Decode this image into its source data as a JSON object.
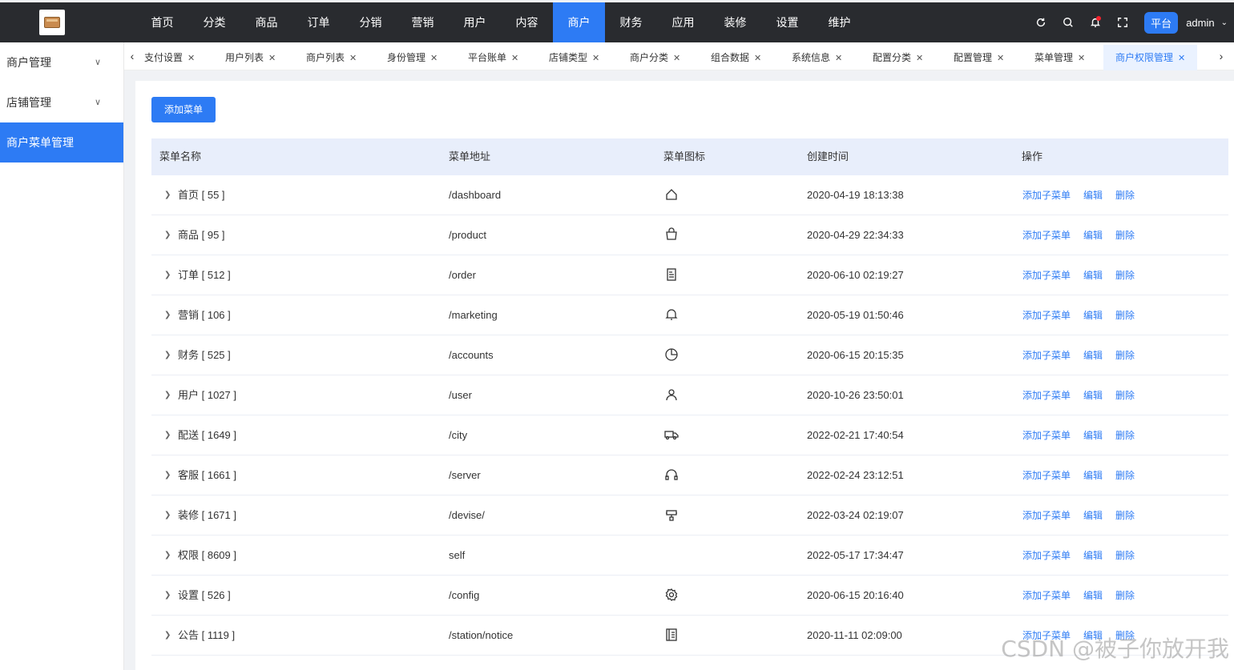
{
  "nav": [
    "首页",
    "分类",
    "商品",
    "订单",
    "分销",
    "营销",
    "用户",
    "内容",
    "商户",
    "财务",
    "应用",
    "装修",
    "设置",
    "维护"
  ],
  "nav_active": "商户",
  "topbar": {
    "platform": "平台",
    "user": "admin"
  },
  "sidebar": [
    {
      "label": "商户管理",
      "chevron": true
    },
    {
      "label": "店铺管理",
      "chevron": true
    },
    {
      "label": "商户菜单管理",
      "active": true
    }
  ],
  "tabs": [
    "支付设置",
    "用户列表",
    "商户列表",
    "身份管理",
    "平台账单",
    "店铺类型",
    "商户分类",
    "组合数据",
    "系统信息",
    "配置分类",
    "配置管理",
    "菜单管理",
    "商户权限管理"
  ],
  "tab_active": "商户权限管理",
  "add_button": "添加菜单",
  "table": {
    "headers": [
      "菜单名称",
      "菜单地址",
      "菜单图标",
      "创建时间",
      "操作"
    ],
    "rows": [
      {
        "name": "首页 [ 55 ]",
        "path": "/dashboard",
        "icon": "home-icon",
        "time": "2020-04-19 18:13:38"
      },
      {
        "name": "商品 [ 95 ]",
        "path": "/product",
        "icon": "shopping-bag-icon",
        "time": "2020-04-29 22:34:33"
      },
      {
        "name": "订单 [ 512 ]",
        "path": "/order",
        "icon": "document-icon",
        "time": "2020-06-10 02:19:27"
      },
      {
        "name": "营销 [ 106 ]",
        "path": "/marketing",
        "icon": "bell-icon",
        "time": "2020-05-19 01:50:46"
      },
      {
        "name": "财务 [ 525 ]",
        "path": "/accounts",
        "icon": "pie-chart-icon",
        "time": "2020-06-15 20:15:35"
      },
      {
        "name": "用户 [ 1027 ]",
        "path": "/user",
        "icon": "user-icon",
        "time": "2020-10-26 23:50:01"
      },
      {
        "name": "配送 [ 1649 ]",
        "path": "/city",
        "icon": "truck-icon",
        "time": "2022-02-21 17:40:54"
      },
      {
        "name": "客服 [ 1661 ]",
        "path": "/server",
        "icon": "headset-icon",
        "time": "2022-02-24 23:12:51"
      },
      {
        "name": "装修 [ 1671 ]",
        "path": "/devise/",
        "icon": "brush-icon",
        "time": "2022-03-24 02:19:07"
      },
      {
        "name": "权限 [ 8609 ]",
        "path": "self",
        "icon": "",
        "time": "2022-05-17 17:34:47"
      },
      {
        "name": "设置 [ 526 ]",
        "path": "/config",
        "icon": "gear-icon",
        "time": "2020-06-15 20:16:40"
      },
      {
        "name": "公告 [ 1119 ]",
        "path": "/station/notice",
        "icon": "notice-icon",
        "time": "2020-11-11 02:09:00"
      }
    ],
    "actions": [
      "添加子菜单",
      "编辑",
      "删除"
    ]
  },
  "watermark": "CSDN @被子你放开我",
  "colors": {
    "accent": "#2d7bf4",
    "topbar": "#292b2f",
    "header_bg": "#e8eefb"
  }
}
